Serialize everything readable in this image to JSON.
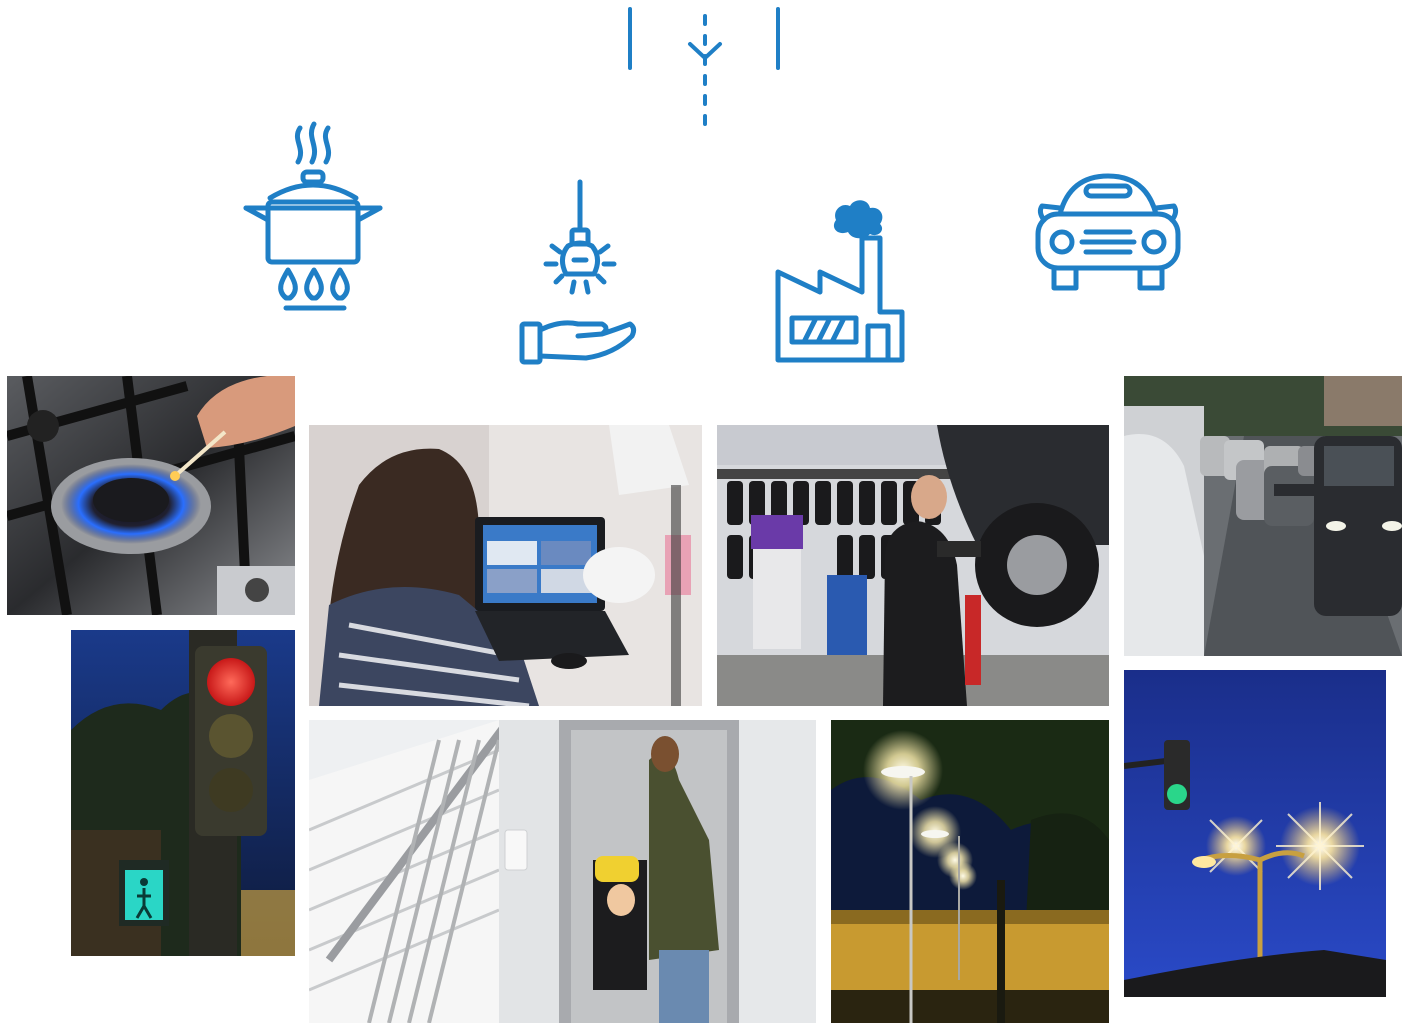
{
  "header": {
    "icon": "energy-flow-icon"
  },
  "icons": [
    {
      "name": "cooking-pot-icon"
    },
    {
      "name": "lightbulb-hand-icon"
    },
    {
      "name": "factory-icon"
    },
    {
      "name": "car-front-icon"
    }
  ],
  "photos": [
    {
      "name": "gas-stove-photo"
    },
    {
      "name": "traffic-light-photo"
    },
    {
      "name": "laptop-woman-photo"
    },
    {
      "name": "mechanic-photo"
    },
    {
      "name": "elevator-photo"
    },
    {
      "name": "streetlamps-photo"
    },
    {
      "name": "traffic-cars-photo"
    },
    {
      "name": "streetlight-night-photo"
    }
  ],
  "colors": {
    "accent": "#1f7fc6"
  }
}
